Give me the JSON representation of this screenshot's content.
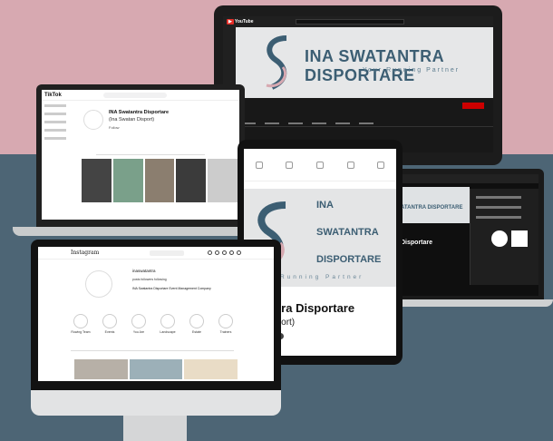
{
  "youtube": {
    "logo": "YouTube",
    "banner_title": "INA SWATANTRA DISPORTARE",
    "banner_tagline": "Your Running Partner",
    "subscribe_label": "SUBSCRIBE"
  },
  "tiktok": {
    "logo": "TikTok",
    "display_name": "INA Swatantra Disportare",
    "handle": "(Ina Swatan Disport)",
    "follow_label": "Follow"
  },
  "tablet": {
    "banner_line1": "INA",
    "banner_line2": "SWATANTRA",
    "banner_line3": "DISPORTARE",
    "banner_tagline": "Running Partner",
    "name": "watantra Disportare",
    "handle": "wan Disport)"
  },
  "youtube_mobile": {
    "banner_text": "ATANTRA DISPORTARE",
    "channel": "Disportare"
  },
  "instagram": {
    "logo": "Instagram",
    "username": "inaswatantra",
    "stats": "posts  followers  following",
    "bio": "INA Swatantra Disportare Event Management Company",
    "highlights": [
      "Rowing Team",
      "Events",
      "You Are",
      "Landscape",
      "Estate",
      "Trainers"
    ]
  },
  "colors": {
    "pink_bg": "#d7a9b1",
    "slate_bg": "#4d6575",
    "brand_blue": "#3c5e73",
    "youtube_red": "#cc0000"
  }
}
